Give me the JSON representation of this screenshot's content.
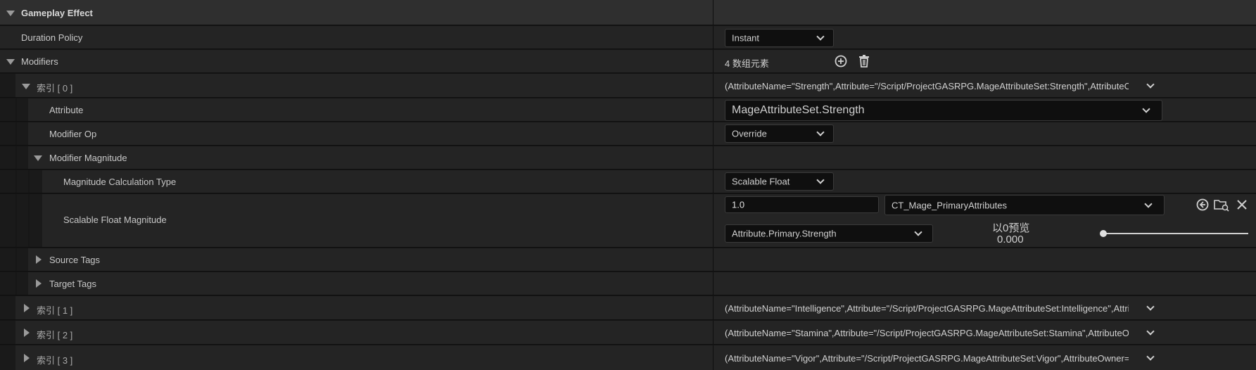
{
  "header": {
    "title": "Gameplay Effect"
  },
  "duration_policy": {
    "label": "Duration Policy",
    "value": "Instant"
  },
  "modifiers": {
    "label": "Modifiers",
    "count_text": "4 数组元素",
    "add_icon": "plus-circle-icon",
    "delete_icon": "trash-icon"
  },
  "index0": {
    "label": "索引 [ 0 ]",
    "summary": "(AttributeName=\"Strength\",Attribute=\"/Script/ProjectGASRPG.MageAttributeSet:Strength\",AttributeO",
    "attribute": {
      "label": "Attribute",
      "value": "MageAttributeSet.Strength"
    },
    "modifier_op": {
      "label": "Modifier Op",
      "value": "Override"
    },
    "modifier_magnitude": {
      "label": "Modifier Magnitude"
    },
    "calc_type": {
      "label": "Magnitude Calculation Type",
      "value": "Scalable Float"
    },
    "scalable_float": {
      "label": "Scalable Float Magnitude",
      "value": "1.0",
      "curve_table": "CT_Mage_PrimaryAttributes",
      "row_name": "Attribute.Primary.Strength",
      "preview_label": "以0预览",
      "preview_value": "0.000",
      "preview_fraction": 0
    },
    "source_tags": {
      "label": "Source Tags"
    },
    "target_tags": {
      "label": "Target Tags"
    }
  },
  "index1": {
    "label": "索引 [ 1 ]",
    "summary": "(AttributeName=\"Intelligence\",Attribute=\"/Script/ProjectGASRPG.MageAttributeSet:Intelligence\",Attri"
  },
  "index2": {
    "label": "索引 [ 2 ]",
    "summary": "(AttributeName=\"Stamina\",Attribute=\"/Script/ProjectGASRPG.MageAttributeSet:Stamina\",AttributeOv"
  },
  "index3": {
    "label": "索引 [ 3 ]",
    "summary": "(AttributeName=\"Vigor\",Attribute=\"/Script/ProjectGASRPG.MageAttributeSet:Vigor\",AttributeOwner=,"
  }
}
